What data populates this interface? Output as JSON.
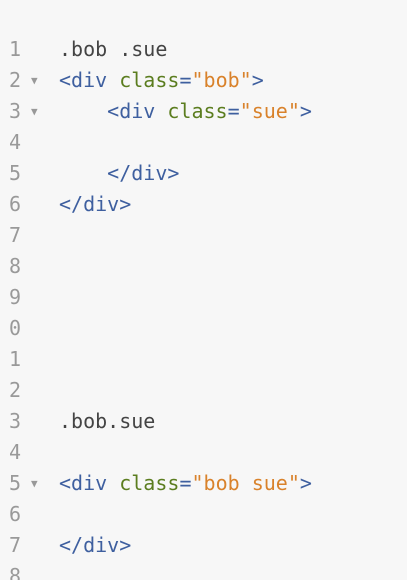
{
  "gutter": {
    "line_numbers": [
      "1",
      "2",
      "3",
      "4",
      "5",
      "6",
      "7",
      "8",
      "9",
      "0",
      "1",
      "2",
      "3",
      "4",
      "5",
      "6",
      "7",
      "8"
    ],
    "fold_marker": "▼"
  },
  "code": {
    "line2_selector": ".bob .sue",
    "line3": {
      "open": "<div",
      "attr": "class",
      "eq": "=",
      "value": "\"bob\"",
      "close": ">"
    },
    "line4": {
      "indent": "    ",
      "open": "<div",
      "attr": "class",
      "eq": "=",
      "value": "\"sue\"",
      "close": ">"
    },
    "line6": {
      "indent": "    ",
      "closing_tag": "</div>"
    },
    "line7": {
      "closing_tag": "</div>"
    },
    "line14_selector": ".bob.sue",
    "line16": {
      "open": "<div",
      "attr": "class",
      "eq": "=",
      "value": "\"bob sue\"",
      "close": ">"
    },
    "line18": {
      "closing_tag": "</div>"
    }
  }
}
